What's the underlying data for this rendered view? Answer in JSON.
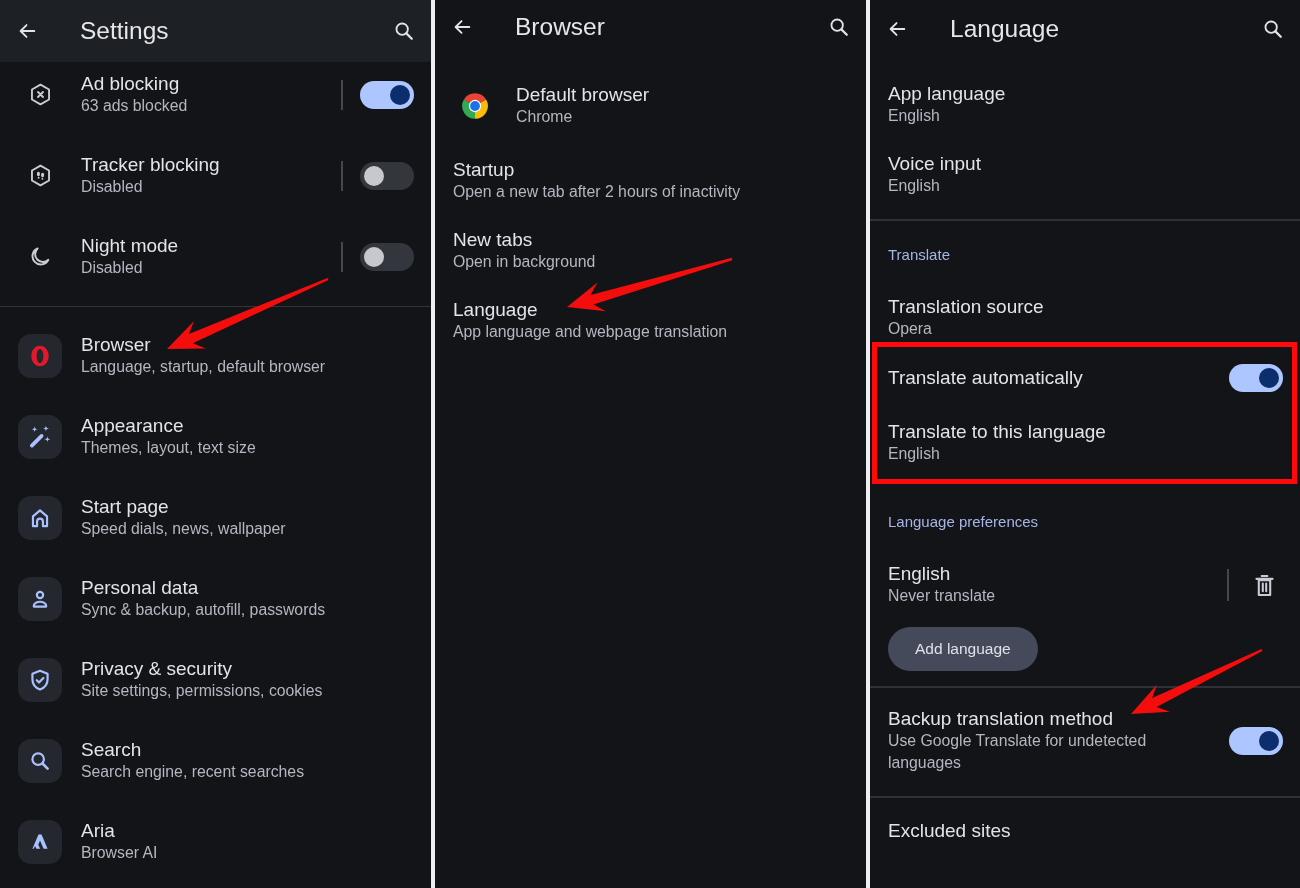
{
  "settings_screen": {
    "title": "Settings",
    "sections": [
      {
        "items": [
          {
            "kind": "toggle",
            "title": "Ad blocking",
            "subtitle": "63 ads blocked",
            "on": true
          },
          {
            "kind": "toggle",
            "title": "Tracker blocking",
            "subtitle": "Disabled",
            "on": false
          },
          {
            "kind": "toggle",
            "title": "Night mode",
            "subtitle": "Disabled",
            "on": false
          }
        ]
      },
      {
        "items": [
          {
            "kind": "category",
            "title": "Browser",
            "subtitle": "Language, startup, default browser"
          },
          {
            "kind": "category",
            "title": "Appearance",
            "subtitle": "Themes, layout, text size"
          },
          {
            "kind": "category",
            "title": "Start page",
            "subtitle": "Speed dials, news, wallpaper"
          },
          {
            "kind": "category",
            "title": "Personal data",
            "subtitle": "Sync & backup, autofill, passwords"
          },
          {
            "kind": "category",
            "title": "Privacy & security",
            "subtitle": "Site settings, permissions, cookies"
          },
          {
            "kind": "category",
            "title": "Search",
            "subtitle": "Search engine, recent searches"
          },
          {
            "kind": "category",
            "title": "Aria",
            "subtitle": "Browser AI"
          }
        ]
      }
    ]
  },
  "browser_screen": {
    "title": "Browser",
    "items": [
      {
        "kind": "app",
        "title": "Default browser",
        "subtitle": "Chrome"
      },
      {
        "kind": "plain",
        "title": "Startup",
        "subtitle": "Open a new tab after 2 hours of inactivity"
      },
      {
        "kind": "plain",
        "title": "New tabs",
        "subtitle": "Open in background"
      },
      {
        "kind": "plain",
        "title": "Language",
        "subtitle": "App language and webpage translation"
      }
    ]
  },
  "language_screen": {
    "title": "Language",
    "sections": [
      {
        "groups": [
          {
            "items": [
              {
                "kind": "plain",
                "title": "App language",
                "subtitle": "English"
              },
              {
                "kind": "plain",
                "title": "Voice input",
                "subtitle": "English"
              }
            ]
          }
        ]
      },
      {
        "groups": [
          {
            "heading": "Translate",
            "items": [
              {
                "kind": "plain",
                "title": "Translation source",
                "subtitle": "Opera",
                "highlighted": false
              },
              {
                "kind": "toggle",
                "title": "Translate automatically",
                "on": true,
                "highlighted": true
              },
              {
                "kind": "plain",
                "title": "Translate to this language",
                "subtitle": "English",
                "highlighted": true
              }
            ]
          },
          {
            "heading": "Language preferences",
            "items": [
              {
                "kind": "language",
                "title": "English",
                "subtitle": "Never translate"
              }
            ],
            "button": "Add language"
          }
        ]
      },
      {
        "groups": [
          {
            "items": [
              {
                "kind": "toggle",
                "title": "Backup translation method",
                "subtitle": "Use Google Translate for undetected languages",
                "on": true
              }
            ]
          }
        ]
      },
      {
        "groups": [
          {
            "items": [
              {
                "kind": "plain",
                "title": "Excluded sites"
              }
            ]
          }
        ]
      }
    ]
  }
}
